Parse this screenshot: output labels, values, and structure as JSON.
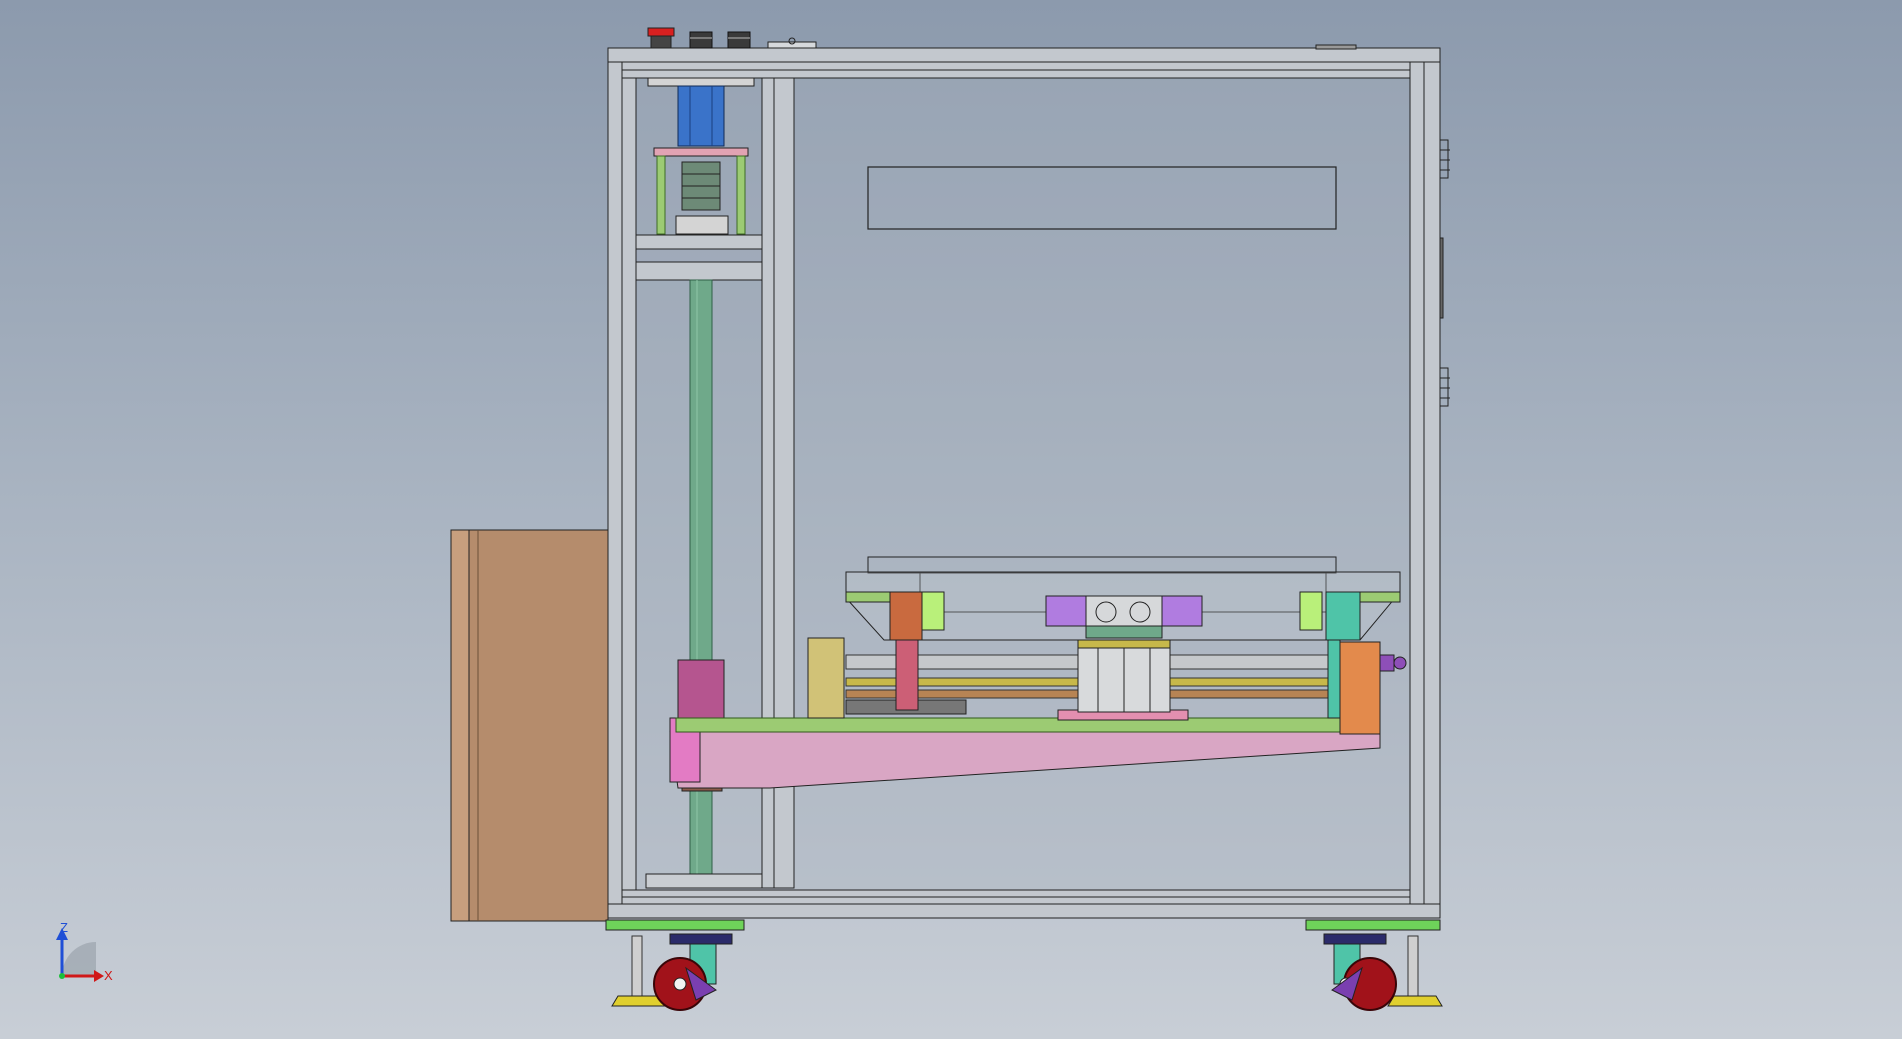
{
  "triad": {
    "z_label": "Z",
    "x_label": "X"
  },
  "colors": {
    "background_top": "#8c9aad",
    "background_bottom": "#c8ced6",
    "frame": "#b9bfc6",
    "outline": "#202020",
    "electrical_box": "#b58c6c",
    "base_plate": "#9ccb73",
    "wedge": "#d9a6c4",
    "motor": "#3a73c9",
    "guide_rod": "#6fa98a",
    "feet": "#6ed35a",
    "wheels": "#a1121a"
  },
  "icons": [
    "emergency-stop-icon",
    "push-button-icon",
    "caster-wheel-icon",
    "axis-triad-icon"
  ]
}
